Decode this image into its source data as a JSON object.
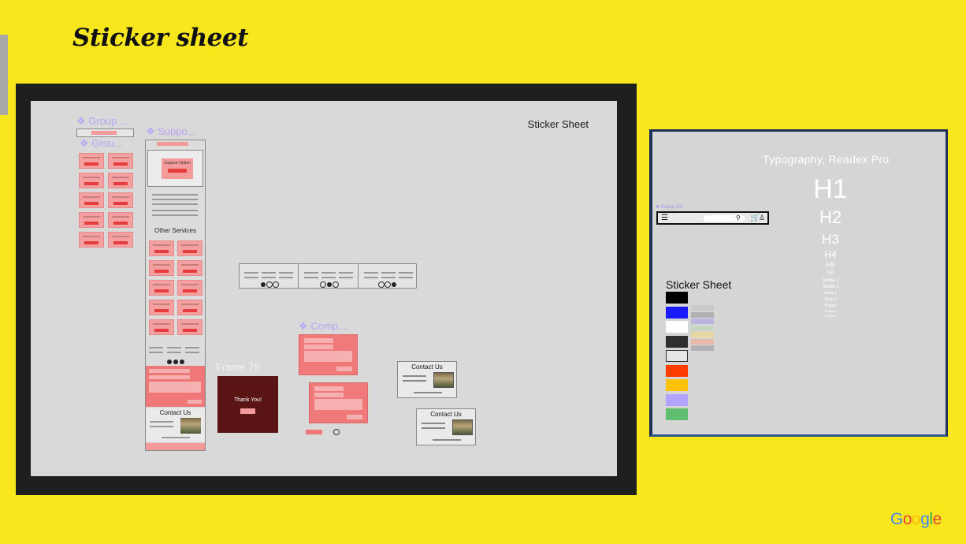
{
  "slide": {
    "title": "Sticker sheet",
    "brand": {
      "letters": [
        "G",
        "o",
        "o",
        "g",
        "l",
        "e"
      ],
      "colors": [
        "#4285F4",
        "#EA4335",
        "#FBBC05",
        "#4285F4",
        "#34A853",
        "#EA4335"
      ]
    },
    "colors": {
      "background": "#f9e71e",
      "frame": "#1f1f1f",
      "canvas": "#d9d9d9"
    }
  },
  "canvas": {
    "label": "Sticker Sheet",
    "component_labels": [
      "❖ Group ...",
      "❖ Grou...",
      "❖ Suppo...",
      "❖ Comp..."
    ],
    "other_services": "Other Services",
    "support_option": "Support Option",
    "frame_label": "Frame 75",
    "thank_you": "Thank You!",
    "contact_title": "Contact Us"
  },
  "panel": {
    "typography_title": "Typography, Readex Pro",
    "headings": [
      "H1",
      "H2",
      "H3",
      "H4",
      "H5",
      "H6"
    ],
    "small_styles": [
      "Subtitle 1",
      "Subtitle 2",
      "Body 1",
      "Body 2",
      "Button",
      "Caption",
      "Overline"
    ],
    "group_label": "❖ Group 157",
    "sticker_title": "Sticker Sheet",
    "swatches": [
      "#000000",
      "#1a1aff",
      "#ffffff",
      "#2e2e2e",
      "#e6e6e6",
      "#ff3d00",
      "#ffc107",
      "#b3a3ff",
      "#5fbf6f"
    ],
    "sub_swatches": [
      "#c9c9c9",
      "#b0b0b0",
      "#b9b3e0",
      "#c6d6c0",
      "#e8d8a0",
      "#e6b9a8",
      "#b3b3b3"
    ]
  }
}
